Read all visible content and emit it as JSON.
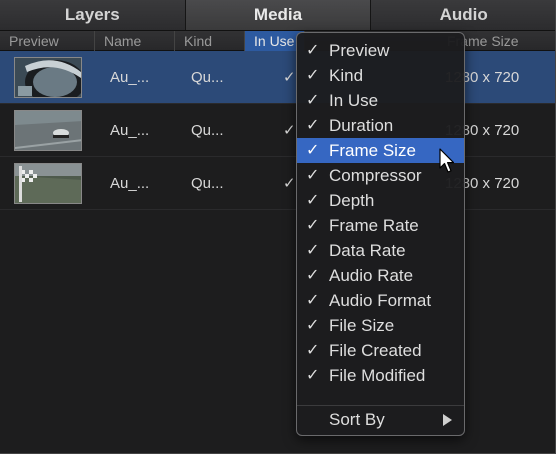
{
  "tabs": [
    "Layers",
    "Media",
    "Audio"
  ],
  "columns": {
    "preview": "Preview",
    "name": "Name",
    "kind": "Kind",
    "in_use": "In Use",
    "frame_size": "Frame Size"
  },
  "rows": [
    {
      "name": "Au_...",
      "kind": "Qu...",
      "in_use": "✓",
      "frame_size": "1280 x 720"
    },
    {
      "name": "Au_...",
      "kind": "Qu...",
      "in_use": "✓",
      "frame_size": "1280 x 720"
    },
    {
      "name": "Au_...",
      "kind": "Qu...",
      "in_use": "✓",
      "frame_size": "1280 x 720"
    }
  ],
  "menu": {
    "check": "✓",
    "items": [
      "Preview",
      "Kind",
      "In Use",
      "Duration",
      "Frame Size",
      "Compressor",
      "Depth",
      "Frame Rate",
      "Data Rate",
      "Audio Rate",
      "Audio Format",
      "File Size",
      "File Created",
      "File Modified"
    ],
    "highlighted": "Frame Size",
    "sort_by": "Sort By"
  },
  "colors": {
    "selection": "#2c4a78",
    "menu_highlight": "#3667c2"
  }
}
